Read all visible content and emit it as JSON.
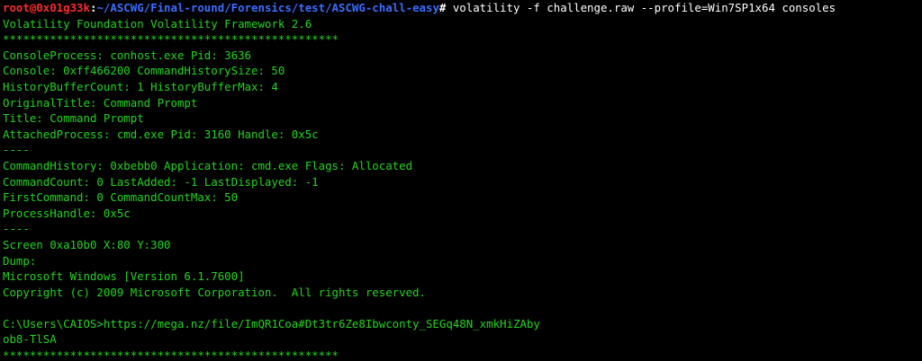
{
  "theme": {
    "background": "#000000",
    "output_color": "#22d41e",
    "prompt_user_color": "#ff2b2b",
    "prompt_path_color": "#3b6dff",
    "command_color": "#ffffff"
  },
  "prompt": {
    "user_host": "root@0x01g33k",
    "colon": ":",
    "path": "~/ASCWG/Final-round/Forensics/test/ASCWG-chall-easy",
    "symbol": "#",
    "command": " volatility -f challenge.raw --profile=Win7SP1x64 consoles"
  },
  "output": [
    "Volatility Foundation Volatility Framework 2.6",
    "**************************************************",
    "ConsoleProcess: conhost.exe Pid: 3636",
    "Console: 0xff466200 CommandHistorySize: 50",
    "HistoryBufferCount: 1 HistoryBufferMax: 4",
    "OriginalTitle: Command Prompt",
    "Title: Command Prompt",
    "AttachedProcess: cmd.exe Pid: 3160 Handle: 0x5c",
    "----",
    "CommandHistory: 0xbebb0 Application: cmd.exe Flags: Allocated",
    "CommandCount: 0 LastAdded: -1 LastDisplayed: -1",
    "FirstCommand: 0 CommandCountMax: 50",
    "ProcessHandle: 0x5c",
    "----",
    "Screen 0xa10b0 X:80 Y:300",
    "Dump:",
    "Microsoft Windows [Version 6.1.7600]",
    "Copyright (c) 2009 Microsoft Corporation.  All rights reserved.",
    "",
    "C:\\Users\\CAIOS>https://mega.nz/file/ImQR1Coa#Dt3tr6Ze8Ibwconty_SEGq48N_xmkHiZAby",
    "ob8-TlSA",
    "**************************************************"
  ]
}
